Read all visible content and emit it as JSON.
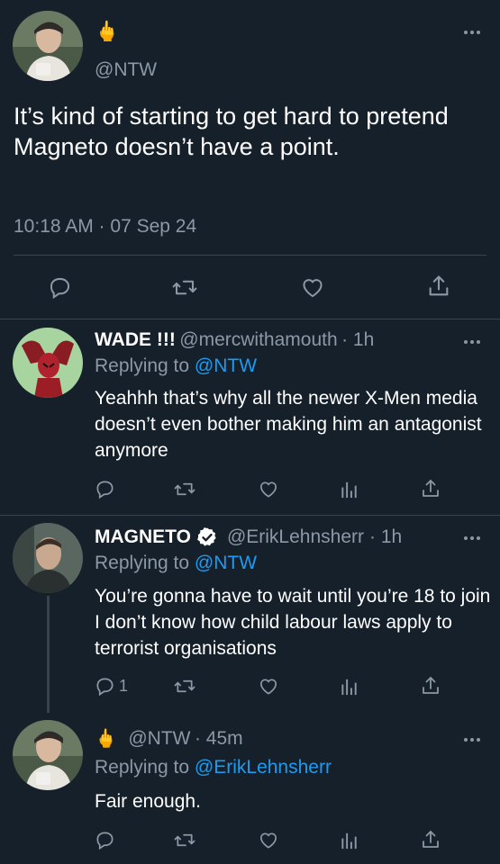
{
  "main_tweet": {
    "emoji": "🖕",
    "handle": "@NTW",
    "text": "It’s kind of starting to get hard to pretend Magneto doesn’t have a point.",
    "timestamp": "10:18 AM · 07 Sep 24"
  },
  "replies": [
    {
      "name": "WADE !!!",
      "handle": "@mercwithamouth",
      "time": "· 1h",
      "replying_label": "Replying to",
      "replying_to": "@NTW",
      "text": "Yeahhh that’s why all the newer X-Men media doesn’t even bother making him an antagonist anymore"
    },
    {
      "name": "MAGNETO",
      "handle": "@ErikLehnsherr",
      "time": "· 1h",
      "replying_label": "Replying to",
      "replying_to": "@NTW",
      "text": "You’re gonna have to wait until you’re 18 to join I don’t know how child labour laws apply to terrorist organisations",
      "reply_count": "1"
    },
    {
      "emoji": "🖕",
      "handle": "@NTW",
      "time": "· 45m",
      "replying_label": "Replying to",
      "replying_to": "@ErikLehnsherr",
      "text": "Fair enough."
    }
  ],
  "icons": [
    "reply-icon",
    "retweet-icon",
    "like-icon",
    "analytics-icon",
    "share-icon",
    "more-icon",
    "verified-badge-icon"
  ],
  "colors": {
    "background": "#15202b",
    "text": "#ffffff",
    "secondary": "#8b98a5",
    "link": "#1d9bf0",
    "divider": "#38444d"
  }
}
